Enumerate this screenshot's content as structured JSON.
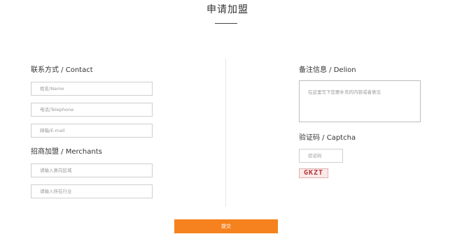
{
  "page_title": "申请加盟",
  "contact": {
    "label": "联系方式 / Contact",
    "name_placeholder": "姓名/Name",
    "phone_placeholder": "电话/Telephone",
    "email_placeholder": "邮箱/E-mail"
  },
  "merchants": {
    "label": "招商加盟 / Merchants",
    "region_placeholder": "请输入意向区域",
    "industry_placeholder": "请输入所在行业"
  },
  "remarks": {
    "label": "备注信息 / Delion",
    "placeholder": "在这里写下您要补充的内容或者意见"
  },
  "captcha": {
    "label": "验证码 / Captcha",
    "input_placeholder": "验证码",
    "image_text": "GKZT"
  },
  "submit_label": "提交",
  "colors": {
    "accent": "#f5821f",
    "border": "#cfcfcf"
  }
}
